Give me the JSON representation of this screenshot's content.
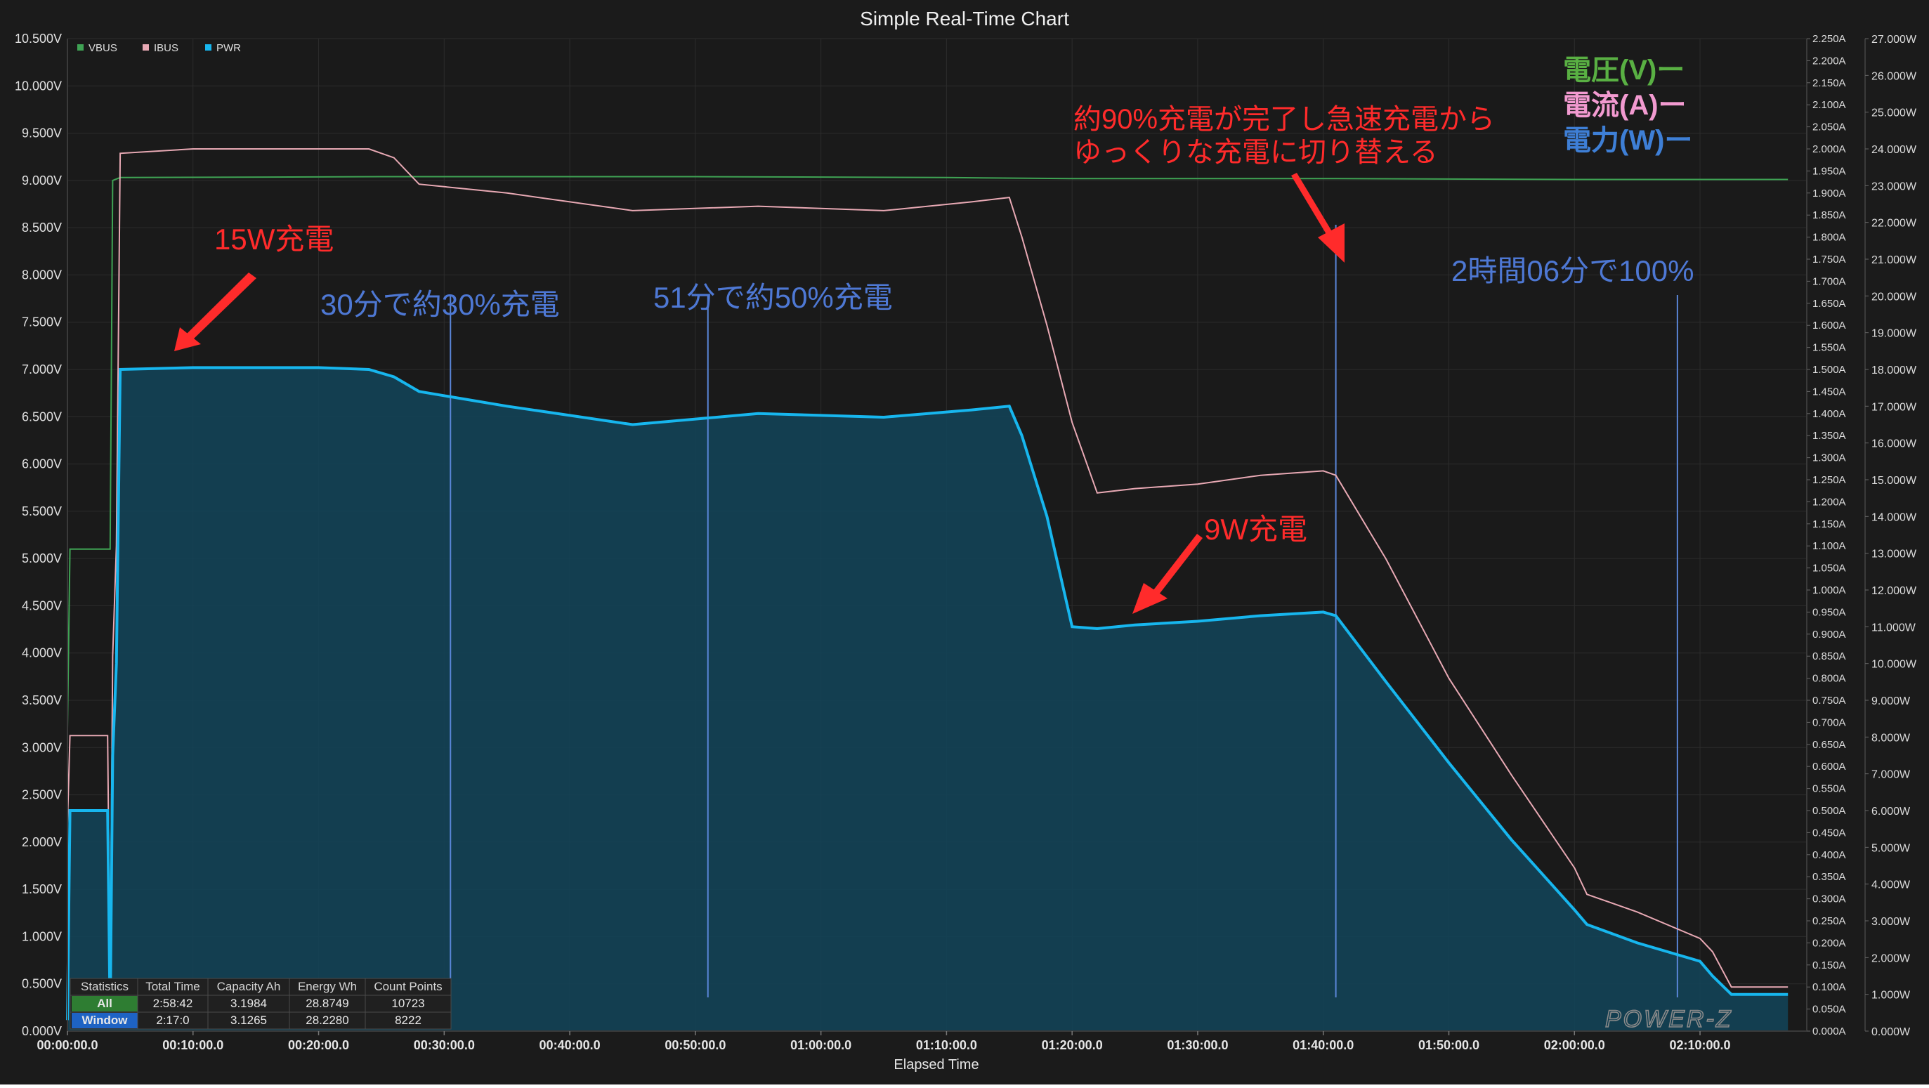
{
  "window": {
    "title": "Simple Real-Time Chart",
    "watermark": "POWER-Z"
  },
  "colors": {
    "vbus": "#3fa354",
    "ibus": "#e8a9b4",
    "pwr": "#17b6ee",
    "pwr_fill": "#134356",
    "annotation_red": "#ff2b2b",
    "annotation_blue": "#4e78d4",
    "legend_green": "#59b043",
    "legend_pink": "#f29ad0",
    "legend_blue": "#3e7fd6",
    "background": "#1b1b1b",
    "plot_background": "#1a1a1a",
    "grid": "#2c2c2c"
  },
  "chart_data": {
    "type": "line",
    "title": "Simple Real-Time Chart",
    "xlabel": "Elapsed Time",
    "x_unit": "minutes",
    "xlim": [
      0,
      138.5
    ],
    "x_ticks": [
      "00:00:00.0",
      "00:10:00.0",
      "00:20:00.0",
      "00:30:00.0",
      "00:40:00.0",
      "00:50:00.0",
      "01:00:00.0",
      "01:10:00.0",
      "01:20:00.0",
      "01:30:00.0",
      "01:40:00.0",
      "01:50:00.0",
      "02:00:00.0",
      "02:10:00.0"
    ],
    "y_left": {
      "label": "VBUS (V)",
      "lim": [
        0,
        10.5
      ],
      "ticks": [
        "0.000V",
        "0.500V",
        "1.000V",
        "1.500V",
        "2.000V",
        "2.500V",
        "3.000V",
        "3.500V",
        "4.000V",
        "4.500V",
        "5.000V",
        "5.500V",
        "6.000V",
        "6.500V",
        "7.000V",
        "7.500V",
        "8.000V",
        "8.500V",
        "9.000V",
        "9.500V",
        "10.000V",
        "10.500V"
      ]
    },
    "y_right_current": {
      "label": "IBUS (A)",
      "lim": [
        0,
        2.25
      ],
      "ticks": [
        "0.000A",
        "0.050A",
        "0.100A",
        "0.150A",
        "0.200A",
        "0.250A",
        "0.300A",
        "0.350A",
        "0.400A",
        "0.450A",
        "0.500A",
        "0.550A",
        "0.600A",
        "0.650A",
        "0.700A",
        "0.750A",
        "0.800A",
        "0.850A",
        "0.900A",
        "0.950A",
        "1.000A",
        "1.050A",
        "1.100A",
        "1.150A",
        "1.200A",
        "1.250A",
        "1.300A",
        "1.350A",
        "1.400A",
        "1.450A",
        "1.500A",
        "1.550A",
        "1.600A",
        "1.650A",
        "1.700A",
        "1.750A",
        "1.800A",
        "1.850A",
        "1.900A",
        "1.950A",
        "2.000A",
        "2.050A",
        "2.100A",
        "2.150A",
        "2.200A",
        "2.250A"
      ]
    },
    "y_right_power": {
      "label": "PWR (W)",
      "lim": [
        0,
        27
      ],
      "ticks": [
        "0.000W",
        "1.000W",
        "2.000W",
        "3.000W",
        "4.000W",
        "5.000W",
        "6.000W",
        "7.000W",
        "8.000W",
        "9.000W",
        "10.000W",
        "11.000W",
        "12.000W",
        "13.000W",
        "14.000W",
        "15.000W",
        "16.000W",
        "17.000W",
        "18.000W",
        "19.000W",
        "20.000W",
        "21.000W",
        "22.000W",
        "23.000W",
        "24.000W",
        "25.000W",
        "26.000W",
        "27.000W"
      ]
    },
    "legend": [
      {
        "name": "VBUS",
        "color": "#3fa354"
      },
      {
        "name": "IBUS",
        "color": "#e8a9b4"
      },
      {
        "name": "PWR",
        "color": "#17b6ee"
      }
    ],
    "series": [
      {
        "name": "VBUS",
        "axis": "left",
        "x": [
          0,
          0.2,
          3.4,
          3.6,
          4.2,
          25,
          50,
          70,
          80,
          100,
          120,
          137
        ],
        "values": [
          3.2,
          5.1,
          5.1,
          9.0,
          9.03,
          9.04,
          9.04,
          9.03,
          9.02,
          9.02,
          9.01,
          9.01
        ]
      },
      {
        "name": "IBUS",
        "axis": "current",
        "x": [
          0,
          0.2,
          3.2,
          3.4,
          3.6,
          3.9,
          4.2,
          10,
          20,
          24,
          26,
          28,
          35,
          45,
          55,
          65,
          72,
          75,
          76,
          78,
          80,
          82,
          85,
          90,
          95,
          100,
          101,
          105,
          110,
          115,
          120,
          121,
          125,
          130,
          131,
          132.5,
          135,
          137
        ],
        "values": [
          0.47,
          0.67,
          0.67,
          0.1,
          0.85,
          1.1,
          1.99,
          2.0,
          2.0,
          2.0,
          1.98,
          1.92,
          1.9,
          1.86,
          1.87,
          1.86,
          1.88,
          1.89,
          1.8,
          1.6,
          1.38,
          1.22,
          1.23,
          1.24,
          1.26,
          1.27,
          1.26,
          1.07,
          0.8,
          0.58,
          0.37,
          0.31,
          0.27,
          0.21,
          0.18,
          0.1,
          0.1,
          0.1
        ]
      },
      {
        "name": "PWR",
        "axis": "power",
        "x": [
          0,
          0.2,
          3.2,
          3.4,
          3.6,
          3.9,
          4.2,
          10,
          20,
          24,
          26,
          28,
          35,
          45,
          55,
          65,
          72,
          75,
          76,
          78,
          80,
          82,
          85,
          90,
          95,
          100,
          101,
          105,
          110,
          115,
          120,
          121,
          125,
          130,
          131,
          132.5,
          135,
          137
        ],
        "values": [
          0.3,
          6.0,
          6.0,
          0.3,
          7.5,
          10.0,
          18.0,
          18.05,
          18.05,
          18.0,
          17.8,
          17.4,
          17.0,
          16.5,
          16.8,
          16.7,
          16.9,
          17.0,
          16.2,
          14.0,
          11.0,
          10.95,
          11.05,
          11.15,
          11.3,
          11.4,
          11.3,
          9.5,
          7.3,
          5.2,
          3.3,
          2.9,
          2.4,
          1.9,
          1.5,
          1.0,
          1.0,
          1.0
        ]
      }
    ],
    "markers": [
      {
        "x": 30.5,
        "label": "30分で約30%充電"
      },
      {
        "x": 51,
        "label": "51分で約50%充電"
      },
      {
        "x": 101,
        "label": ""
      },
      {
        "x": 128.2,
        "label": "2時間06分で100%"
      }
    ],
    "annotations": {
      "watt15": "15W充電",
      "watt9": "9W充電",
      "switch_line1": "約90%充電が完了し急速充電から",
      "switch_line2": "ゆっくりな充電に切り替える"
    },
    "right_legend": {
      "voltage": "電圧(V)ー",
      "current": "電流(A)ー",
      "power": "電力(W)ー"
    },
    "stats_table": {
      "headers": [
        "Statistics",
        "Total Time",
        "Capacity Ah",
        "Energy Wh",
        "Count Points"
      ],
      "rows": [
        [
          "All",
          "2:58:42",
          "3.1984",
          "28.8749",
          "10723"
        ],
        [
          "Window",
          "2:17:0",
          "3.1265",
          "28.2280",
          "8222"
        ]
      ]
    }
  }
}
